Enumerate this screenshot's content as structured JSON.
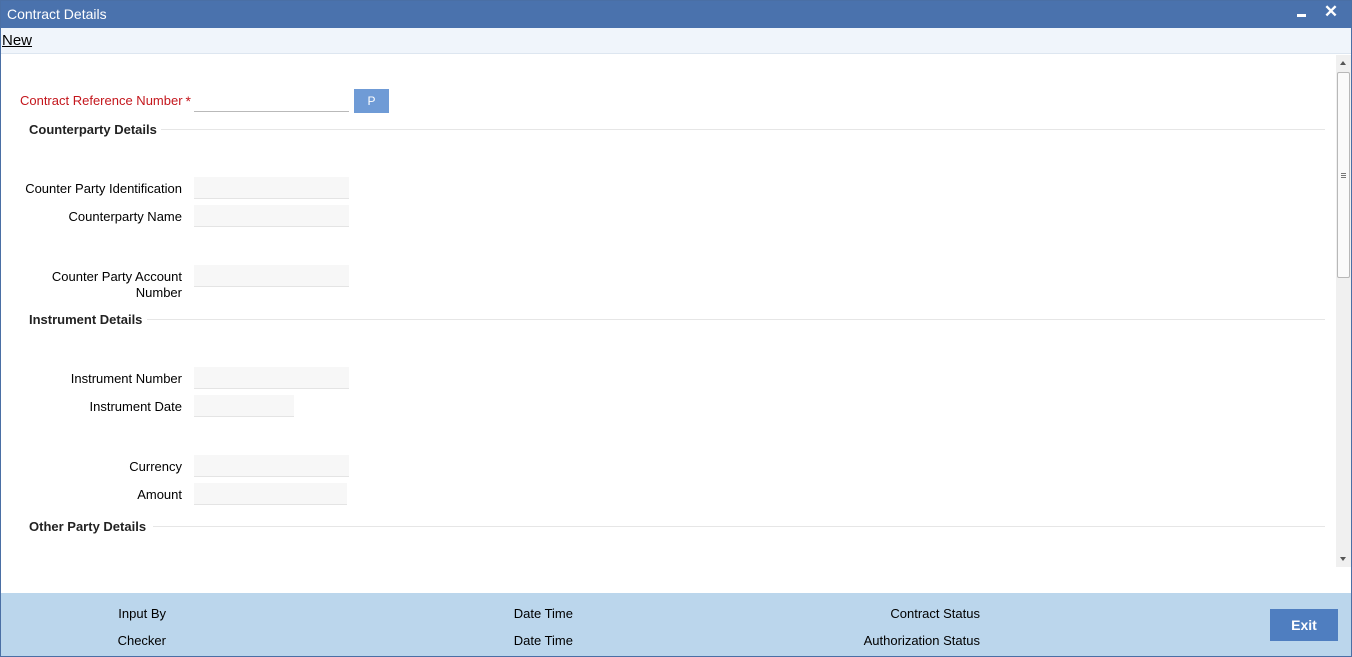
{
  "window": {
    "title": "Contract Details"
  },
  "menubar": {
    "new_label": "New"
  },
  "form": {
    "contract_reference_label": "Contract Reference Number",
    "required_marker": "*",
    "contract_reference_value": "",
    "pick_button_label": "P",
    "sections": {
      "counterparty": "Counterparty Details",
      "instrument": "Instrument Details",
      "other_party": "Other Party Details"
    },
    "labels": {
      "counter_party_identification": "Counter Party Identification",
      "counterparty_name": "Counterparty Name",
      "counter_party_account_number_line1": "Counter Party Account",
      "counter_party_account_number_line2": "Number",
      "instrument_number": "Instrument Number",
      "instrument_date": "Instrument Date",
      "currency": "Currency",
      "amount": "Amount"
    }
  },
  "footer": {
    "input_by": "Input By",
    "checker": "Checker",
    "date_time_1": "Date Time",
    "date_time_2": "Date Time",
    "contract_status": "Contract Status",
    "authorization_status": "Authorization Status",
    "exit_label": "Exit"
  },
  "colors": {
    "titlebar": "#4a72ad",
    "required_label": "#c4161c",
    "footer_bg": "#bbd6ec",
    "exit_button": "#4f7ec0",
    "pick_button": "#6f9bd6"
  },
  "icons": {
    "minimize": "minimize-icon",
    "close": "close-icon"
  }
}
